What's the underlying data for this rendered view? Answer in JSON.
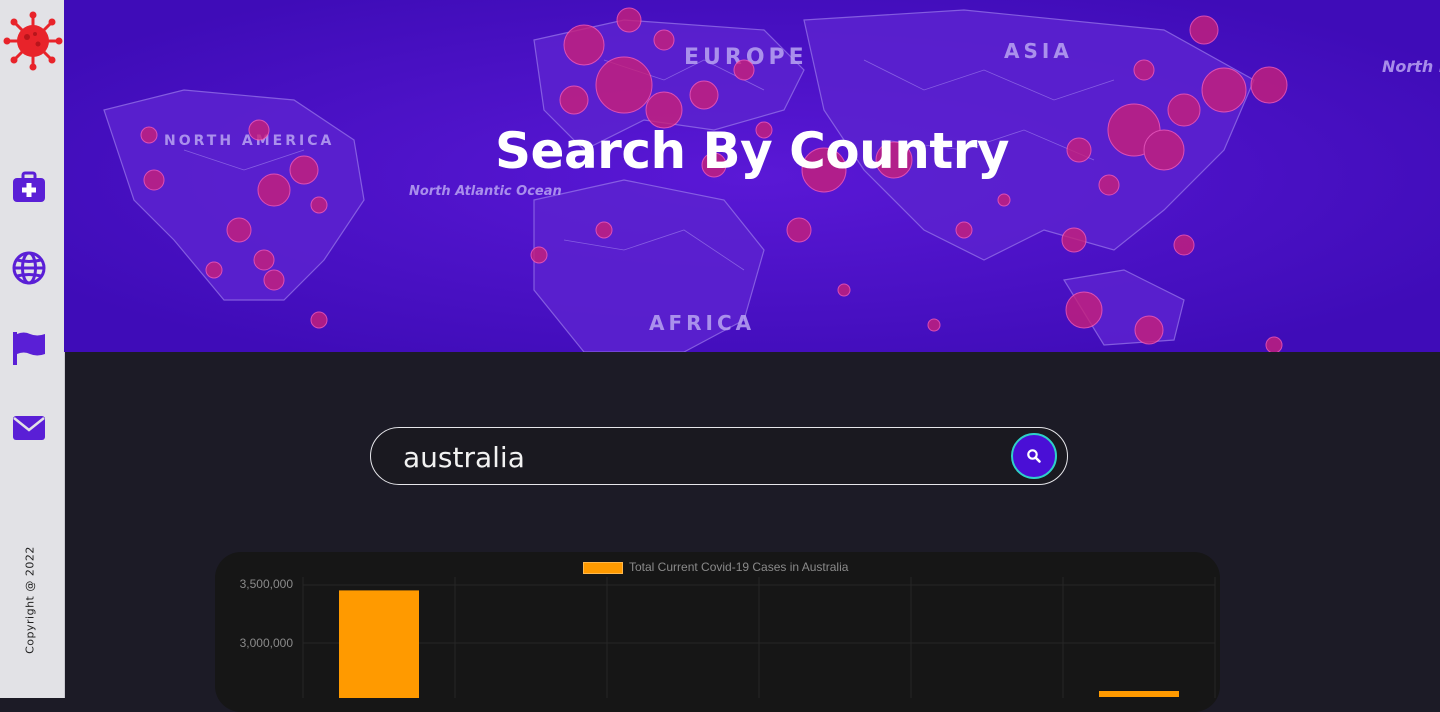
{
  "sidebar": {
    "logo": "virus-logo-icon",
    "nav": [
      {
        "icon": "medical-kit-icon"
      },
      {
        "icon": "globe-icon"
      },
      {
        "icon": "flag-icon"
      },
      {
        "icon": "envelope-icon"
      }
    ],
    "copyright": "Copyright @ 2022"
  },
  "hero": {
    "title": "Search By Country",
    "map_labels": [
      "EUROPE",
      "ASIA",
      "NORTH AMERICA",
      "North Atlantic Ocean",
      "AFRICA",
      "North Pacific Ocean"
    ]
  },
  "search": {
    "value": "australia",
    "button_icon": "search-icon"
  },
  "colors": {
    "accent": "#4a0fd6",
    "bar": "#ff9a00",
    "hero_bg": "#4a10c8",
    "page_bg": "#1c1b26"
  },
  "chart_data": {
    "type": "bar",
    "legend": [
      "Total Current Covid-19 Cases in Australia"
    ],
    "series": [
      {
        "name": "Total Current Covid-19 Cases in Australia",
        "values": [
          3450000,
          0,
          0,
          0,
          0,
          2500000
        ]
      }
    ],
    "y_ticks": [
      "3,500,000",
      "3,000,000"
    ],
    "ylim": [
      2500000,
      3500000
    ],
    "grid": true
  }
}
